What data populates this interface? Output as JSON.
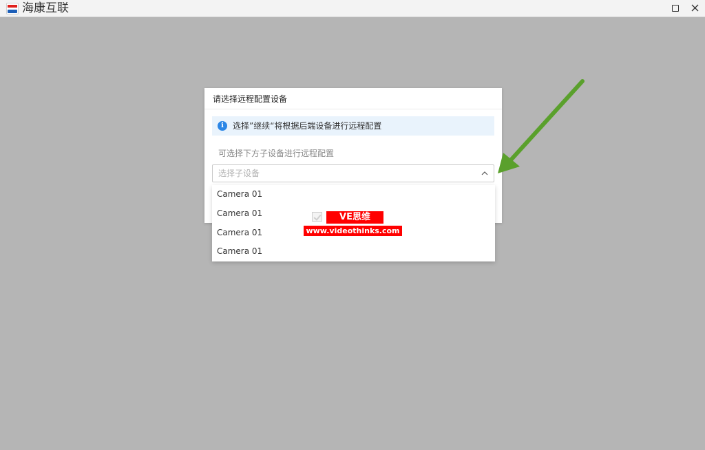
{
  "window": {
    "app_title": "海康互联",
    "logo_icon": "hikvision-logo-icon",
    "controls": {
      "maximize_icon": "maximize-icon",
      "close_icon": "close-icon"
    }
  },
  "dialog": {
    "title": "请选择远程配置设备",
    "info": {
      "icon": "info-icon",
      "glyph": "i",
      "text": "选择”继续“将根据后端设备进行远程配置"
    },
    "hint": "可选择下方子设备进行远程配置",
    "select": {
      "placeholder": "选择子设备",
      "expanded": true,
      "chevron_icon": "chevron-up-icon"
    }
  },
  "dropdown": {
    "options": [
      {
        "label": "Camera 01"
      },
      {
        "label": "Camera 01"
      },
      {
        "label": "Camera 01"
      },
      {
        "label": "Camera 01"
      }
    ]
  },
  "watermark": {
    "label": "VE思维",
    "url": "www.videothinks.com"
  },
  "colors": {
    "overlay": "#b5b5b5",
    "info_bg": "#e9f3fc",
    "info_icon": "#2b86e6",
    "arrow": "#5aa02c",
    "watermark_red": "#ff0000"
  }
}
